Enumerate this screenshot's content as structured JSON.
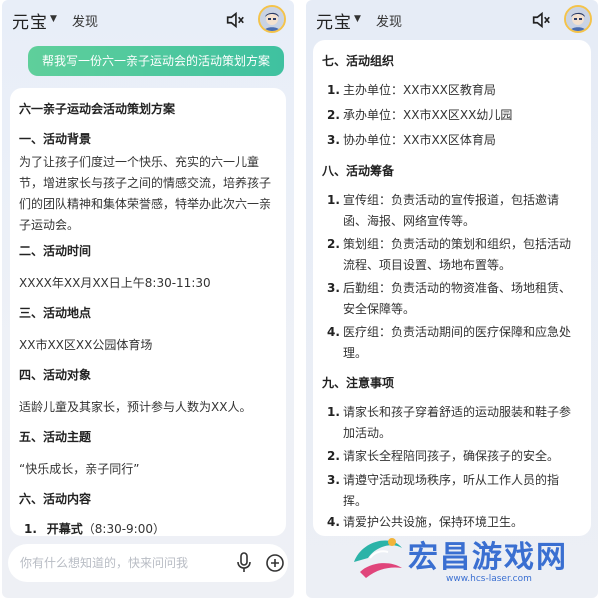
{
  "left": {
    "brand": "元宝",
    "discover": "发现",
    "user_message": "帮我写一份六一亲子运动会的活动策划方案",
    "title": "六一亲子运动会活动策划方案",
    "sections": [
      {
        "heading": "一、活动背景",
        "text": "为了让孩子们度过一个快乐、充实的六一儿童节，增进家长与孩子之间的情感交流，培养孩子们的团队精神和集体荣誉感，特举办此次六一亲子运动会。"
      },
      {
        "heading": "二、活动时间",
        "text": "XXXX年XX月XX日上午8:30-11:30"
      },
      {
        "heading": "三、活动地点",
        "text": "XX市XX区XX公园体育场"
      },
      {
        "heading": "四、活动对象",
        "text": "适龄儿童及其家长，预计参与人数为XX人。"
      },
      {
        "heading": "五、活动主题",
        "text": "“快乐成长，亲子同行”"
      },
      {
        "heading": "六、活动内容",
        "text": ""
      }
    ],
    "first_item_num": "1.",
    "first_item_label": "开幕式",
    "first_item_time": "（8:30-9:00）",
    "input_placeholder": "你有什么想知道的，快来问问我"
  },
  "right": {
    "brand": "元宝",
    "discover": "发现",
    "sec7": {
      "heading": "七、活动组织",
      "items": [
        {
          "num": "1.",
          "text": "主办单位：XX市XX区教育局"
        },
        {
          "num": "2.",
          "text": "承办单位：XX市XX区XX幼儿园"
        },
        {
          "num": "3.",
          "text": "协办单位：XX市XX区体育局"
        }
      ]
    },
    "sec8": {
      "heading": "八、活动筹备",
      "items": [
        {
          "num": "1.",
          "text": "宣传组：负责活动的宣传报道，包括邀请函、海报、网络宣传等。"
        },
        {
          "num": "2.",
          "text": "策划组：负责活动的策划和组织，包括活动流程、项目设置、场地布置等。"
        },
        {
          "num": "3.",
          "text": "后勤组：负责活动的物资准备、场地租赁、安全保障等。"
        },
        {
          "num": "4.",
          "text": "医疗组：负责活动期间的医疗保障和应急处理。"
        }
      ]
    },
    "sec9": {
      "heading": "九、注意事项",
      "items": [
        {
          "num": "1.",
          "text": "请家长和孩子穿着舒适的运动服装和鞋子参加活动。"
        },
        {
          "num": "2.",
          "text": "请家长全程陪同孩子，确保孩子的安全。"
        },
        {
          "num": "3.",
          "text": "请遵守活动现场秩序，听从工作人员的指挥。"
        },
        {
          "num": "4.",
          "text": "请爱护公共设施，保持环境卫生。"
        }
      ]
    }
  },
  "watermark": {
    "text": "宏昌游戏网",
    "url": "www.hcs-laser.com"
  },
  "colors": {
    "accent_green": "#4cc79e",
    "watermark_blue": "#3a6fd1"
  }
}
